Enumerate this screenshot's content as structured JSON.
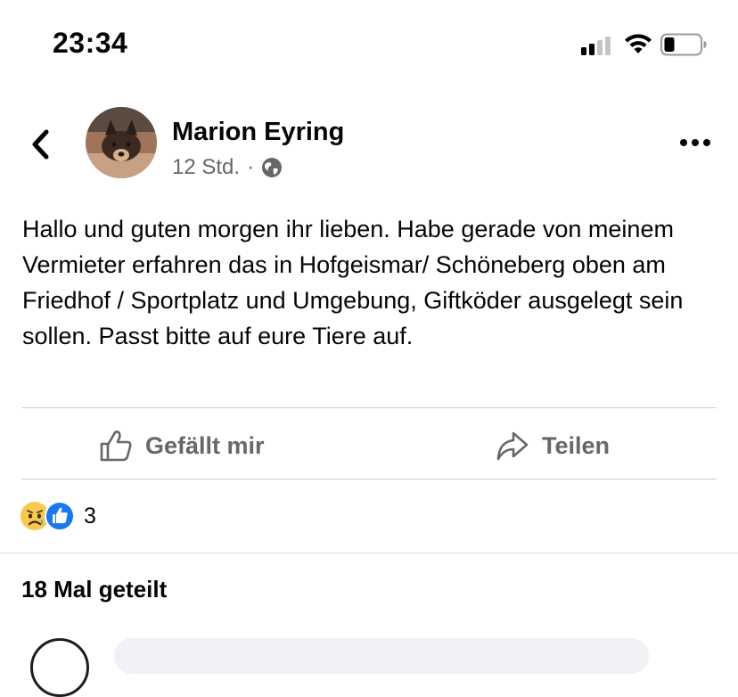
{
  "status_bar": {
    "time": "23:34",
    "icons": [
      "signal-icon",
      "wifi-icon",
      "battery-icon"
    ]
  },
  "post": {
    "author": "Marion Eyring",
    "timestamp": "12 Std.",
    "separator": "·",
    "privacy_icon": "globe-icon",
    "text": "Hallo und guten morgen ihr lieben. Habe gerade von meinem Vermieter erfahren das in Hofgeismar/ Schöneberg oben am Friedhof / Sportplatz und Umgebung, Giftköder ausgelegt sein sollen.  Passt bitte auf eure Tiere auf."
  },
  "actions": {
    "like_label": "Gefällt mir",
    "share_label": "Teilen"
  },
  "reactions": {
    "icons": [
      "sad-emoji-icon",
      "like-reaction-icon"
    ],
    "count": "3"
  },
  "shares": {
    "label": "18 Mal geteilt"
  },
  "colors": {
    "text": "#050505",
    "secondary": "#65676b",
    "like_blue": "#1877f2",
    "divider": "#ced0d4"
  }
}
